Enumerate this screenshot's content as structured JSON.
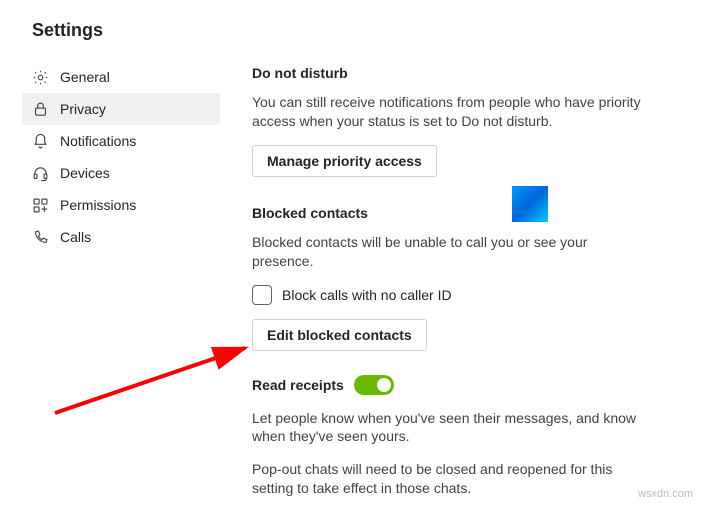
{
  "title": "Settings",
  "sidebar": {
    "items": [
      {
        "label": "General"
      },
      {
        "label": "Privacy"
      },
      {
        "label": "Notifications"
      },
      {
        "label": "Devices"
      },
      {
        "label": "Permissions"
      },
      {
        "label": "Calls"
      }
    ]
  },
  "dnd": {
    "title": "Do not disturb",
    "desc": "You can still receive notifications from people who have priority access when your status is set to Do not disturb.",
    "button": "Manage priority access"
  },
  "blocked": {
    "title": "Blocked contacts",
    "desc": "Blocked contacts will be unable to call you or see your presence.",
    "checkbox_label": "Block calls with no caller ID",
    "button": "Edit blocked contacts"
  },
  "receipts": {
    "title": "Read receipts",
    "desc1": "Let people know when you've seen their messages, and know when they've seen yours.",
    "desc2": "Pop-out chats will need to be closed and reopened for this setting to take effect in those chats."
  },
  "watermark": "wsxdn.com"
}
